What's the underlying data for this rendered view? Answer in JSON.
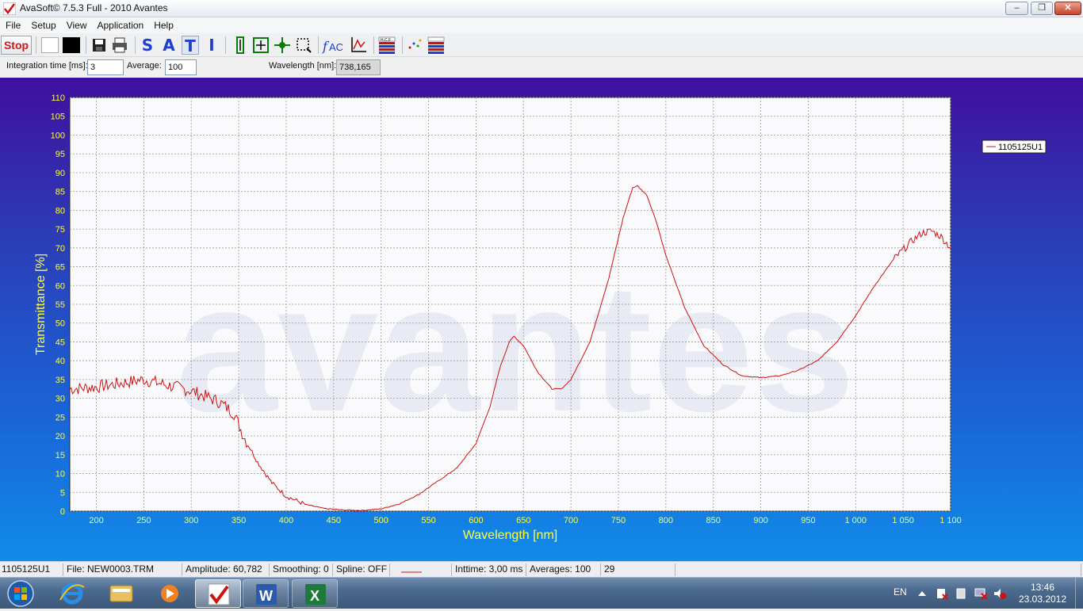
{
  "window": {
    "title": "AvaSoft© 7.5.3 Full - 2010 Avantes"
  },
  "menu": [
    "File",
    "Setup",
    "View",
    "Application",
    "Help"
  ],
  "toolbar": {
    "stop_label": "Stop",
    "letters": [
      "S",
      "A",
      "T",
      "I"
    ],
    "icons": [
      "white-square-icon",
      "black-square-icon",
      "save-icon",
      "print-icon",
      "scale-vertical-icon",
      "autoscale-icon",
      "pan-icon",
      "zoom-rectangle-icon",
      "fac-icon",
      "axis-icon",
      "hcf-icon",
      "scatter-icon",
      "color-table-icon"
    ]
  },
  "params": {
    "integration_label": "Integration time [ms]:",
    "integration_value": "3",
    "average_label": "Average:",
    "average_value": "100",
    "wavelength_label": "Wavelength [nm]:",
    "wavelength_value": "738,165"
  },
  "watermark": "avantes",
  "chart_data": {
    "type": "line",
    "xlabel": "Wavelength [nm]",
    "ylabel": "Transmittance [%]",
    "xlim": [
      172,
      1100
    ],
    "ylim": [
      0,
      110
    ],
    "x_ticks": [
      200,
      250,
      300,
      350,
      400,
      450,
      500,
      550,
      600,
      650,
      700,
      750,
      800,
      850,
      900,
      950,
      1000,
      1050,
      1100
    ],
    "x_tick_labels": [
      "200",
      "250",
      "300",
      "350",
      "400",
      "450",
      "500",
      "550",
      "600",
      "650",
      "700",
      "750",
      "800",
      "850",
      "900",
      "950",
      "1 000",
      "1 050",
      "1 100"
    ],
    "y_ticks": [
      0,
      5,
      10,
      15,
      20,
      25,
      30,
      35,
      40,
      45,
      50,
      55,
      60,
      65,
      70,
      75,
      80,
      85,
      90,
      95,
      100,
      105,
      110
    ],
    "grid": true,
    "legend_position": "right",
    "series": [
      {
        "name": "1105125U1",
        "color": "#d01010",
        "x": [
          172,
          200,
          250,
          300,
          330,
          345,
          355,
          370,
          385,
          400,
          420,
          440,
          460,
          480,
          500,
          520,
          540,
          560,
          580,
          600,
          615,
          625,
          635,
          640,
          650,
          665,
          680,
          690,
          700,
          720,
          740,
          755,
          765,
          770,
          780,
          790,
          800,
          820,
          840,
          860,
          880,
          900,
          920,
          940,
          960,
          980,
          1000,
          1020,
          1040,
          1060,
          1070,
          1080,
          1090,
          1100
        ],
        "y": [
          32.5,
          33,
          35,
          32,
          29,
          26,
          20,
          13,
          7.5,
          4,
          1.8,
          0.7,
          0.3,
          0.2,
          0.6,
          2,
          4.5,
          8,
          11.5,
          18,
          28,
          38,
          45,
          46.5,
          44,
          37,
          32.5,
          32.5,
          35,
          45,
          62,
          78,
          86,
          86.5,
          84,
          77,
          68,
          54,
          44,
          39,
          36,
          35.5,
          36,
          37.5,
          40,
          45,
          52,
          60,
          67,
          72,
          74,
          74.5,
          73,
          70
        ]
      }
    ]
  },
  "status": {
    "series": "1105125U1",
    "file": "File: NEW0003.TRM",
    "amplitude": "Amplitude: 60,782",
    "smoothing": "Smoothing: 0",
    "spline": "Spline: OFF",
    "inttime": "Inttime: 3,00 ms",
    "averages": "Averages: 100",
    "count": "29"
  },
  "taskbar": {
    "items": [
      "start-orb",
      "internet-explorer",
      "windows-explorer",
      "media-player",
      "avasoft",
      "word",
      "excel"
    ],
    "lang": "EN",
    "time": "13:46",
    "date": "23.03.2012"
  }
}
